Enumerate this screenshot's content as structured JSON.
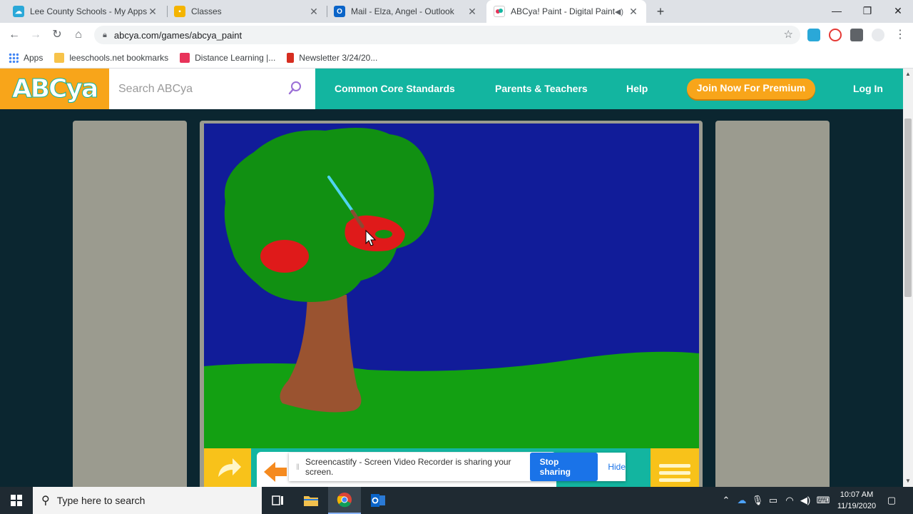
{
  "browser": {
    "tabs": [
      {
        "title": "Lee County Schools - My Apps",
        "favicon_color": "#2aa8d8"
      },
      {
        "title": "Classes",
        "favicon_color": "#f4b400"
      },
      {
        "title": "Mail - Elza, Angel - Outlook",
        "favicon_color": "#0a64c8"
      },
      {
        "title": "ABCya! Paint - Digital Paintin",
        "favicon_color": "#ffffff"
      }
    ],
    "active_tab_index": 3,
    "new_tab_label": "+",
    "window_controls": {
      "minimize": "—",
      "maximize": "❐",
      "close": "✕"
    },
    "address": "abcya.com/games/abcya_paint",
    "bookmarks": [
      {
        "label": "Apps",
        "color": "#4285f4"
      },
      {
        "label": "leeschools.net bookmarks",
        "color": "#f7c34a"
      },
      {
        "label": "Distance Learning |...",
        "color": "#e8335a"
      },
      {
        "label": "Newsletter 3/24/20...",
        "color": "#d62d20"
      }
    ]
  },
  "site": {
    "logo": "ABCya",
    "search_placeholder": "Search ABCya",
    "nav": [
      "Common Core Standards",
      "Parents & Teachers",
      "Help"
    ],
    "premium_button": "Join Now For Premium",
    "login": "Log In"
  },
  "screencastify": {
    "message": "Screencastify - Screen Video Recorder is sharing your screen.",
    "stop_button": "Stop sharing",
    "hide_link": "Hide"
  },
  "taskbar": {
    "search_placeholder": "Type here to search",
    "time": "10:07 AM",
    "date": "11/19/2020"
  },
  "colors": {
    "sky": "#111c99",
    "grass": "#13a012",
    "tree_leaves": "#119012",
    "trunk": "#9a5330",
    "apple": "#df1a1a",
    "header_teal": "#13b5a0",
    "orange": "#f8a51a"
  }
}
